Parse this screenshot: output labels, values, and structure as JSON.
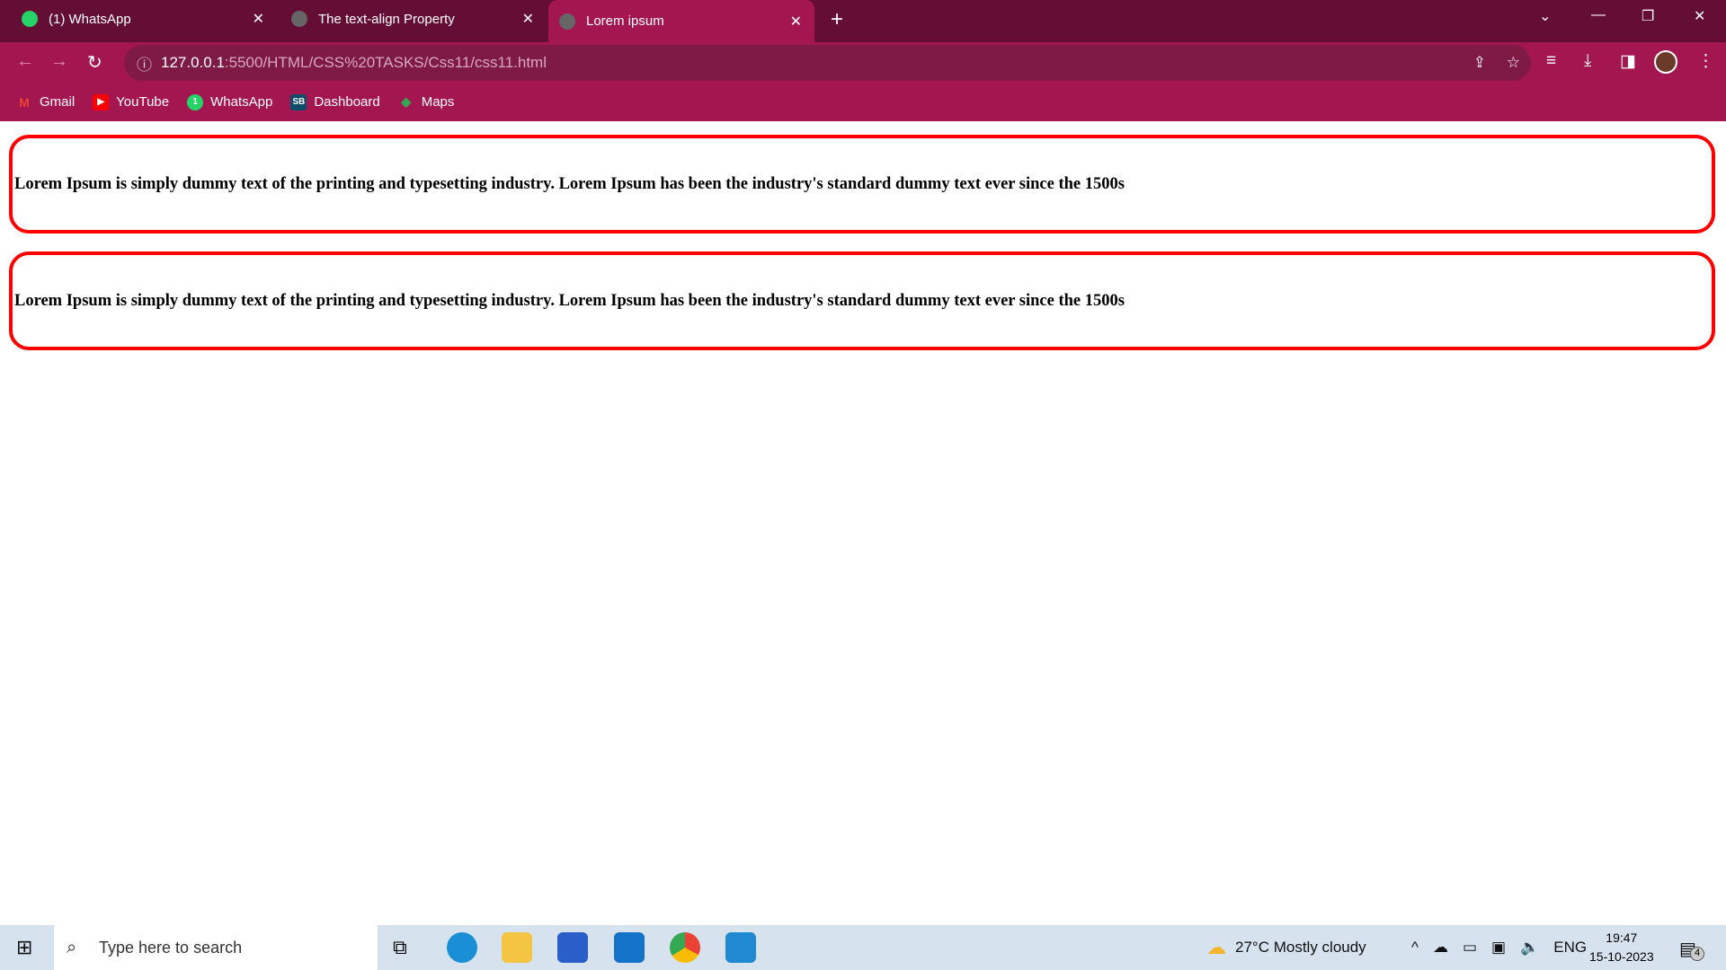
{
  "tabs": [
    {
      "label": "(1) WhatsApp"
    },
    {
      "label": "The text-align Property"
    },
    {
      "label": "Lorem ipsum"
    }
  ],
  "address": {
    "host": "127.0.0.1",
    "path": ":5500/HTML/CSS%20TASKS/Css11/css11.html"
  },
  "bookmarks": [
    {
      "label": "Gmail",
      "icon": "M"
    },
    {
      "label": "YouTube",
      "icon": "▶"
    },
    {
      "label": "WhatsApp",
      "icon": "1"
    },
    {
      "label": "Dashboard",
      "icon": "SB"
    },
    {
      "label": "Maps",
      "icon": "◆"
    }
  ],
  "content": {
    "para1": "Lorem Ipsum is simply dummy text of the printing and typesetting industry. Lorem Ipsum has been the industry's standard dummy text ever since the 1500s",
    "para2": "Lorem Ipsum is simply dummy text of the printing and typesetting industry. Lorem Ipsum has been the industry's standard dummy text ever since the 1500s"
  },
  "taskbar": {
    "search_placeholder": "Type here to search",
    "weather": "27°C  Mostly cloudy",
    "lang": "ENG",
    "time": "19:47",
    "date": "15-10-2023",
    "notifications": "4"
  },
  "colors": {
    "frame": "#640d35",
    "toolbar": "#a3164f",
    "border": "#ff0000"
  }
}
